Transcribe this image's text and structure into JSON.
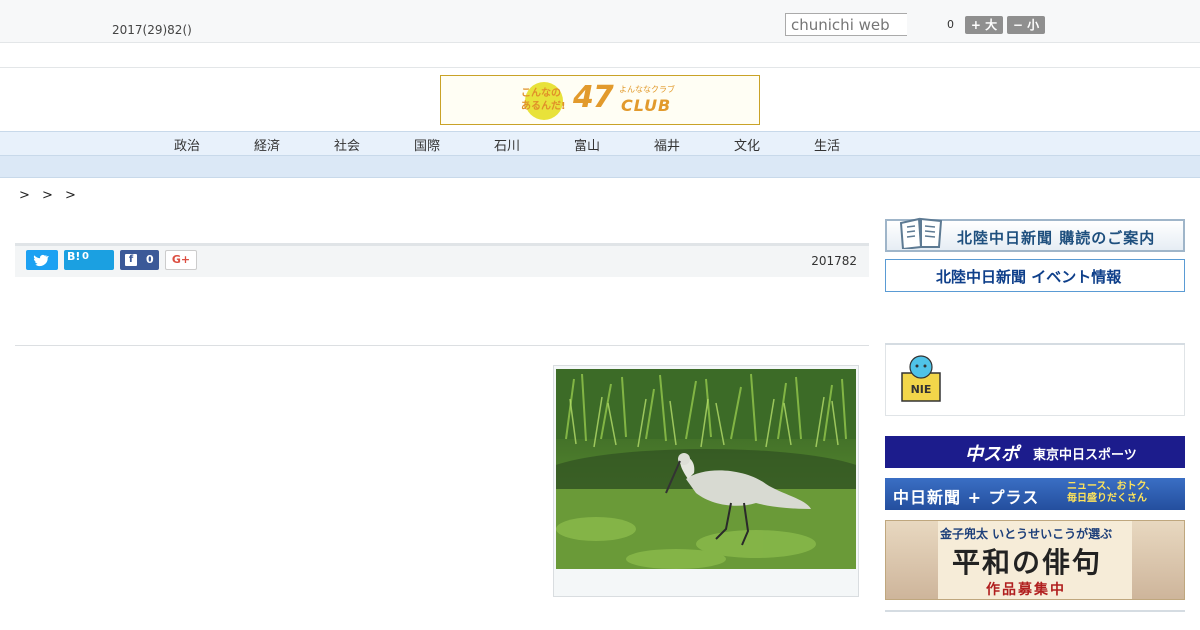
{
  "header": {
    "date": "2017(29)82()",
    "search_placeholder": "chunichi web",
    "font_size_value": "0",
    "font_larger": "+ 大",
    "font_smaller": "− 小"
  },
  "banner": {
    "tagline": "こんなの あるんだ!",
    "brand_number": "47",
    "brand_sub": "よんななクラブ",
    "brand_name": "CLUB"
  },
  "nav": {
    "items": [
      "政治",
      "経済",
      "社会",
      "国際",
      "石川",
      "富山",
      "福井",
      "文化",
      "生活"
    ]
  },
  "breadcrumb": "> > >",
  "share": {
    "twitter_icon": "twitter-icon",
    "hatena_label": "B!",
    "hatena_count": "0",
    "facebook_label": "f",
    "facebook_count": "0",
    "gplus_label": "G+",
    "date": "201782"
  },
  "sidebar": {
    "subscribe_text": "北陸中日新聞 購読のご案内",
    "event_text": "北陸中日新聞 イベント情報",
    "nie_label": "NIE",
    "chuspo_main": "中スポ",
    "chuspo_sub": "東京中日スポーツ",
    "plus_main": "中日新聞 + プラス",
    "plus_sub_1": "ニュース、おトク、",
    "plus_sub_2": "毎日盛りだくさん",
    "haiku_line1": "金子兜太 いとうせいこうが選ぶ",
    "haiku_line2": "平和の俳句",
    "haiku_line3": "作品募集中"
  },
  "colors": {
    "nav_bg": "#e8f1fb",
    "twitter": "#1da1f2",
    "hatena": "#1ba0e1",
    "facebook": "#3b5998",
    "banner_gold": "#e29a2c"
  }
}
